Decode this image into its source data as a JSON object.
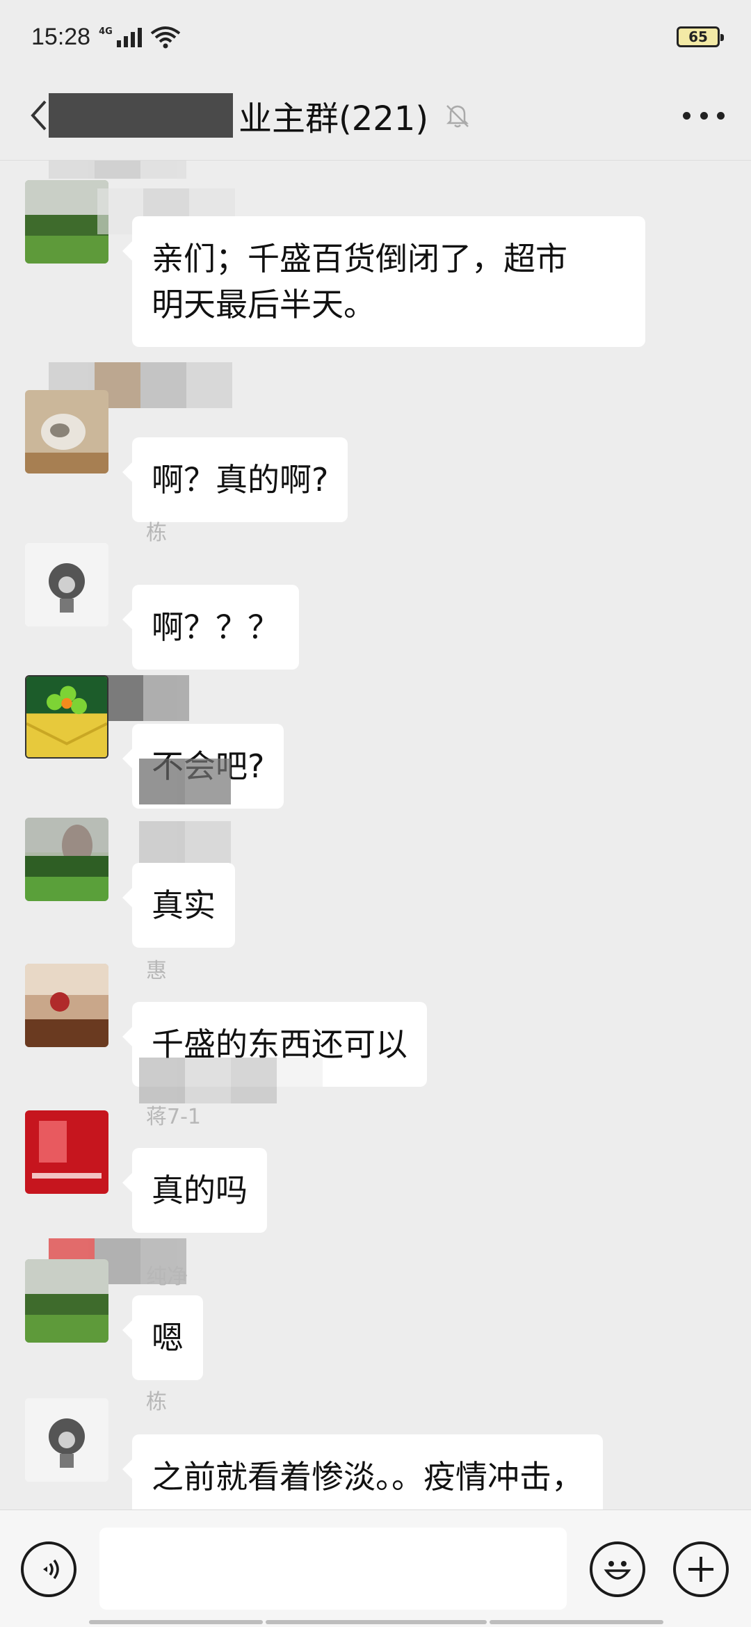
{
  "status_bar": {
    "time": "15:28",
    "network": "4G",
    "battery": "65"
  },
  "header": {
    "title": "业主群(221)"
  },
  "messages": [
    {
      "nick": "",
      "text_lines": [
        "亲们；千盛百货倒闭了，超市",
        "明天最后半天。"
      ],
      "avatar": "garden"
    },
    {
      "nick": "",
      "text_lines": [
        "啊？真的啊?"
      ],
      "avatar": "cat"
    },
    {
      "nick": "栋",
      "text_lines": [
        "啊？？？"
      ],
      "avatar": "monkey"
    },
    {
      "nick": "",
      "text_lines": [
        "不会吧?"
      ],
      "avatar": "clover"
    },
    {
      "nick": "",
      "text_lines": [
        "真实"
      ],
      "avatar": "rock-garden"
    },
    {
      "nick": "惠",
      "text_lines": [
        "千盛的东西还可以"
      ],
      "avatar": "tea"
    },
    {
      "nick": "蒋7-1",
      "text_lines": [
        "真的吗"
      ],
      "avatar": "red-card"
    },
    {
      "nick": "纯净",
      "text_lines": [
        "嗯"
      ],
      "avatar": "garden"
    },
    {
      "nick": "栋",
      "text_lines": [
        "之前就看着惨淡。。疫情冲击，"
      ],
      "avatar": "monkey"
    }
  ],
  "input": {
    "placeholder": ""
  },
  "colors": {
    "background": "#ededed",
    "bubble": "#ffffff",
    "input_bar": "#f6f6f6"
  },
  "icons": [
    "back-icon",
    "mute-bell-icon",
    "more-icon",
    "voice-icon",
    "emoji-icon",
    "plus-icon"
  ]
}
